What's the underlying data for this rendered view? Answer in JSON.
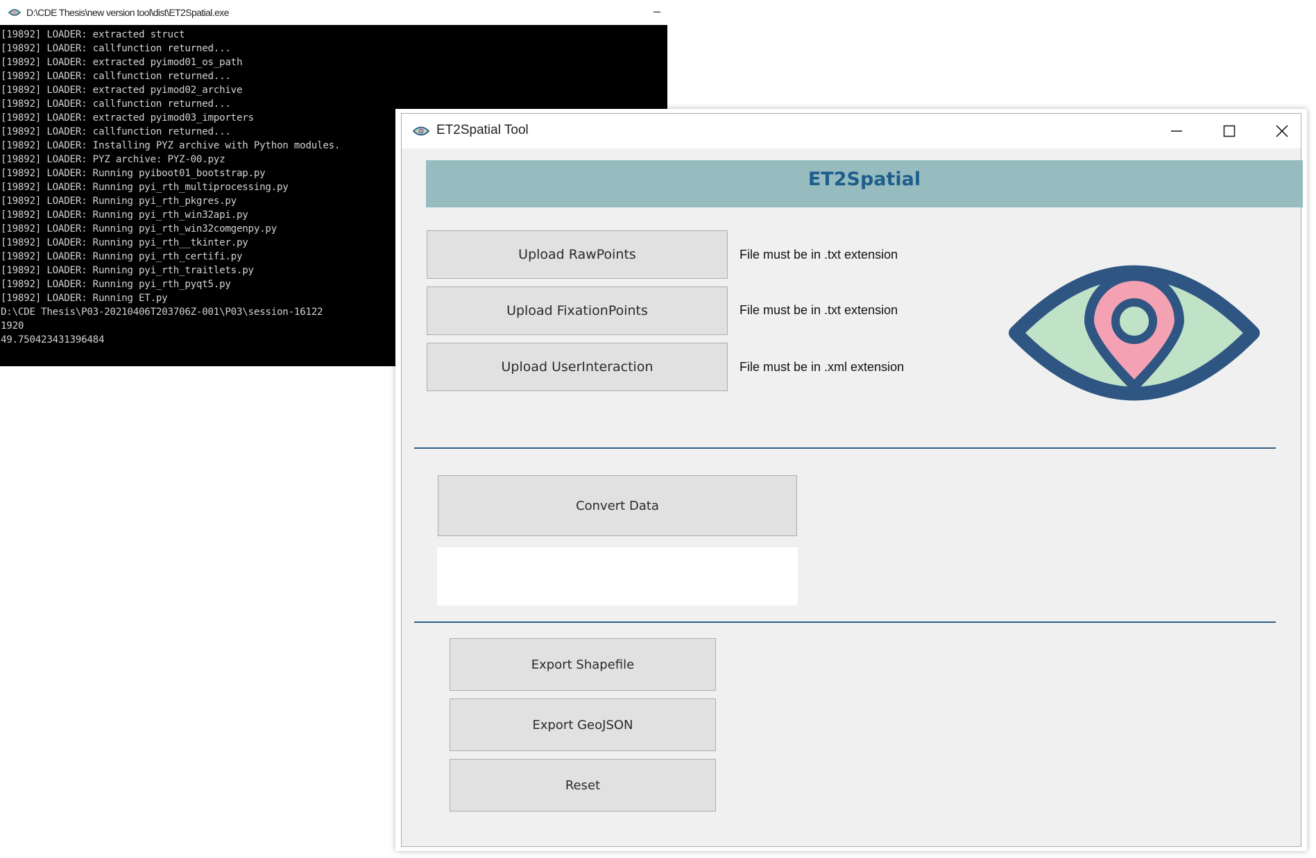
{
  "console": {
    "title": "D:\\CDE Thesis\\new version tool\\dist\\ET2Spatial.exe",
    "minimize_glyph": "–",
    "lines": [
      "[19892] LOADER: extracted struct",
      "[19892] LOADER: callfunction returned...",
      "[19892] LOADER: extracted pyimod01_os_path",
      "[19892] LOADER: callfunction returned...",
      "[19892] LOADER: extracted pyimod02_archive",
      "[19892] LOADER: callfunction returned...",
      "[19892] LOADER: extracted pyimod03_importers",
      "[19892] LOADER: callfunction returned...",
      "[19892] LOADER: Installing PYZ archive with Python modules.",
      "[19892] LOADER: PYZ archive: PYZ-00.pyz",
      "[19892] LOADER: Running pyiboot01_bootstrap.py",
      "[19892] LOADER: Running pyi_rth_multiprocessing.py",
      "[19892] LOADER: Running pyi_rth_pkgres.py",
      "[19892] LOADER: Running pyi_rth_win32api.py",
      "[19892] LOADER: Running pyi_rth_win32comgenpy.py",
      "[19892] LOADER: Running pyi_rth__tkinter.py",
      "[19892] LOADER: Running pyi_rth_certifi.py",
      "[19892] LOADER: Running pyi_rth_traitlets.py",
      "[19892] LOADER: Running pyi_rth_pyqt5.py",
      "[19892] LOADER: Running ET.py",
      "D:\\CDE Thesis\\P03-20210406T203706Z-001\\P03\\session-16122",
      "1920",
      "49.750423431396484"
    ]
  },
  "app": {
    "title": "ET2Spatial Tool",
    "banner": "ET2Spatial",
    "uploads": [
      {
        "label": "Upload RawPoints",
        "hint": "File must be in .txt extension"
      },
      {
        "label": "Upload FixationPoints",
        "hint": "File must be in .txt extension"
      },
      {
        "label": "Upload UserInteraction",
        "hint": "File must be in .xml extension"
      }
    ],
    "convert_label": "Convert Data",
    "status_text": "",
    "export_shapefile_label": "Export Shapefile",
    "export_geojson_label": "Export GeoJSON",
    "reset_label": "Reset"
  },
  "colors": {
    "banner_bg": "#96bcbf",
    "banner_text": "#1f5d8d",
    "eye_outline": "#2f5583",
    "eye_fill": "#c0e3c8",
    "pin_fill": "#f4a2b3",
    "separator": "#2e5f86"
  },
  "icons": {
    "app": "eye-icon",
    "minimize": "minimize-icon",
    "maximize": "maximize-icon",
    "close": "close-icon",
    "logo": "eye-location-pin-logo"
  }
}
